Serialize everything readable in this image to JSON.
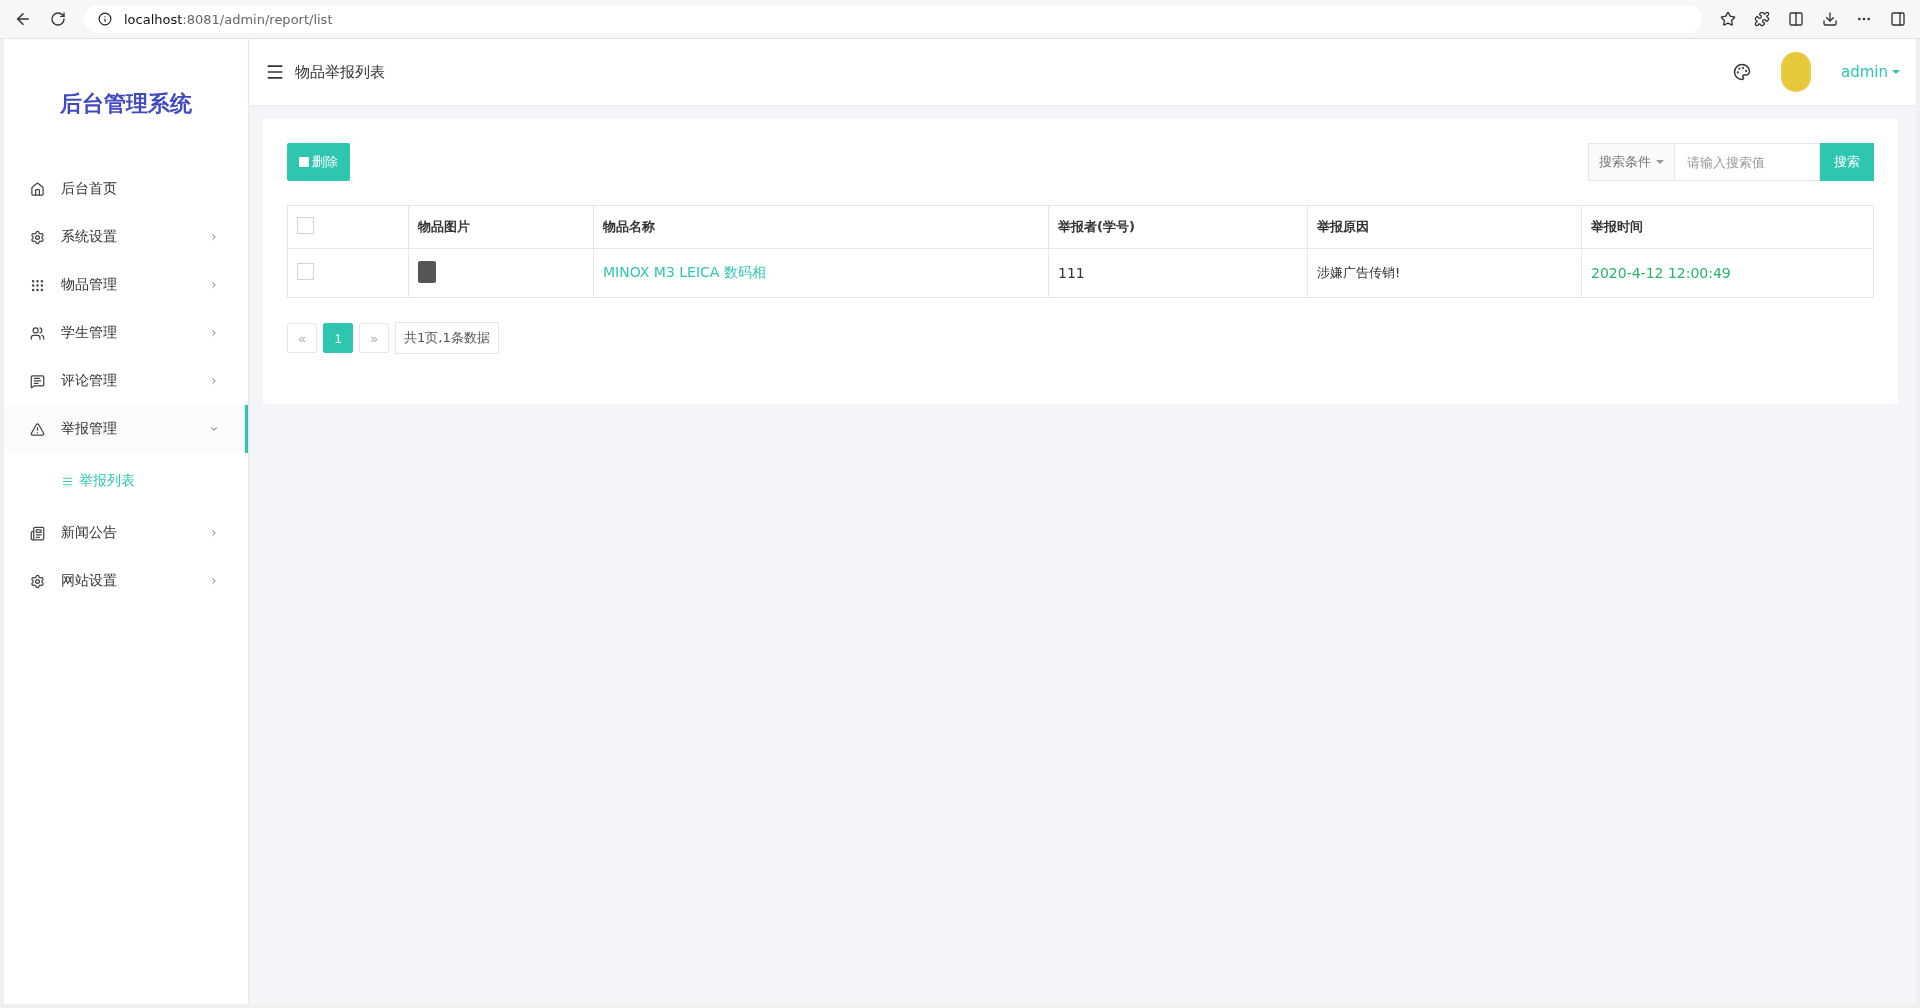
{
  "browser": {
    "url_host": "localhost",
    "url_rest": ":8081/admin/report/list"
  },
  "sidebar": {
    "title": "后台管理系统",
    "items": [
      {
        "label": "后台首页",
        "kind": "link",
        "expanded": false
      },
      {
        "label": "系统设置",
        "kind": "menu",
        "expanded": false
      },
      {
        "label": "物品管理",
        "kind": "menu",
        "expanded": false
      },
      {
        "label": "学生管理",
        "kind": "menu",
        "expanded": false
      },
      {
        "label": "评论管理",
        "kind": "menu",
        "expanded": false
      },
      {
        "label": "举报管理",
        "kind": "menu",
        "expanded": true,
        "children": [
          {
            "label": "举报列表",
            "selected": true
          }
        ]
      },
      {
        "label": "新闻公告",
        "kind": "menu",
        "expanded": false
      },
      {
        "label": "网站设置",
        "kind": "menu",
        "expanded": false
      }
    ]
  },
  "header": {
    "title": "物品举报列表",
    "user": "admin"
  },
  "toolbar": {
    "delete": "删除",
    "search_condition": "搜索条件",
    "search_placeholder": "请输入搜索值",
    "search_button": "搜索"
  },
  "table": {
    "columns": [
      "物品图片",
      "物品名称",
      "举报者(学号)",
      "举报原因",
      "举报时间"
    ],
    "all_checked": false,
    "rows": [
      {
        "checked": false,
        "name": "MINOX M3 LEICA 数码相",
        "reporter": "111",
        "reason": "涉嫌广告传销!",
        "time": "2020-4-12 12:00:49"
      }
    ]
  },
  "pagination": {
    "prev": "«",
    "pages": [
      {
        "label": "1",
        "selected": true
      }
    ],
    "next": "»",
    "summary": "共1页,1条数据"
  }
}
